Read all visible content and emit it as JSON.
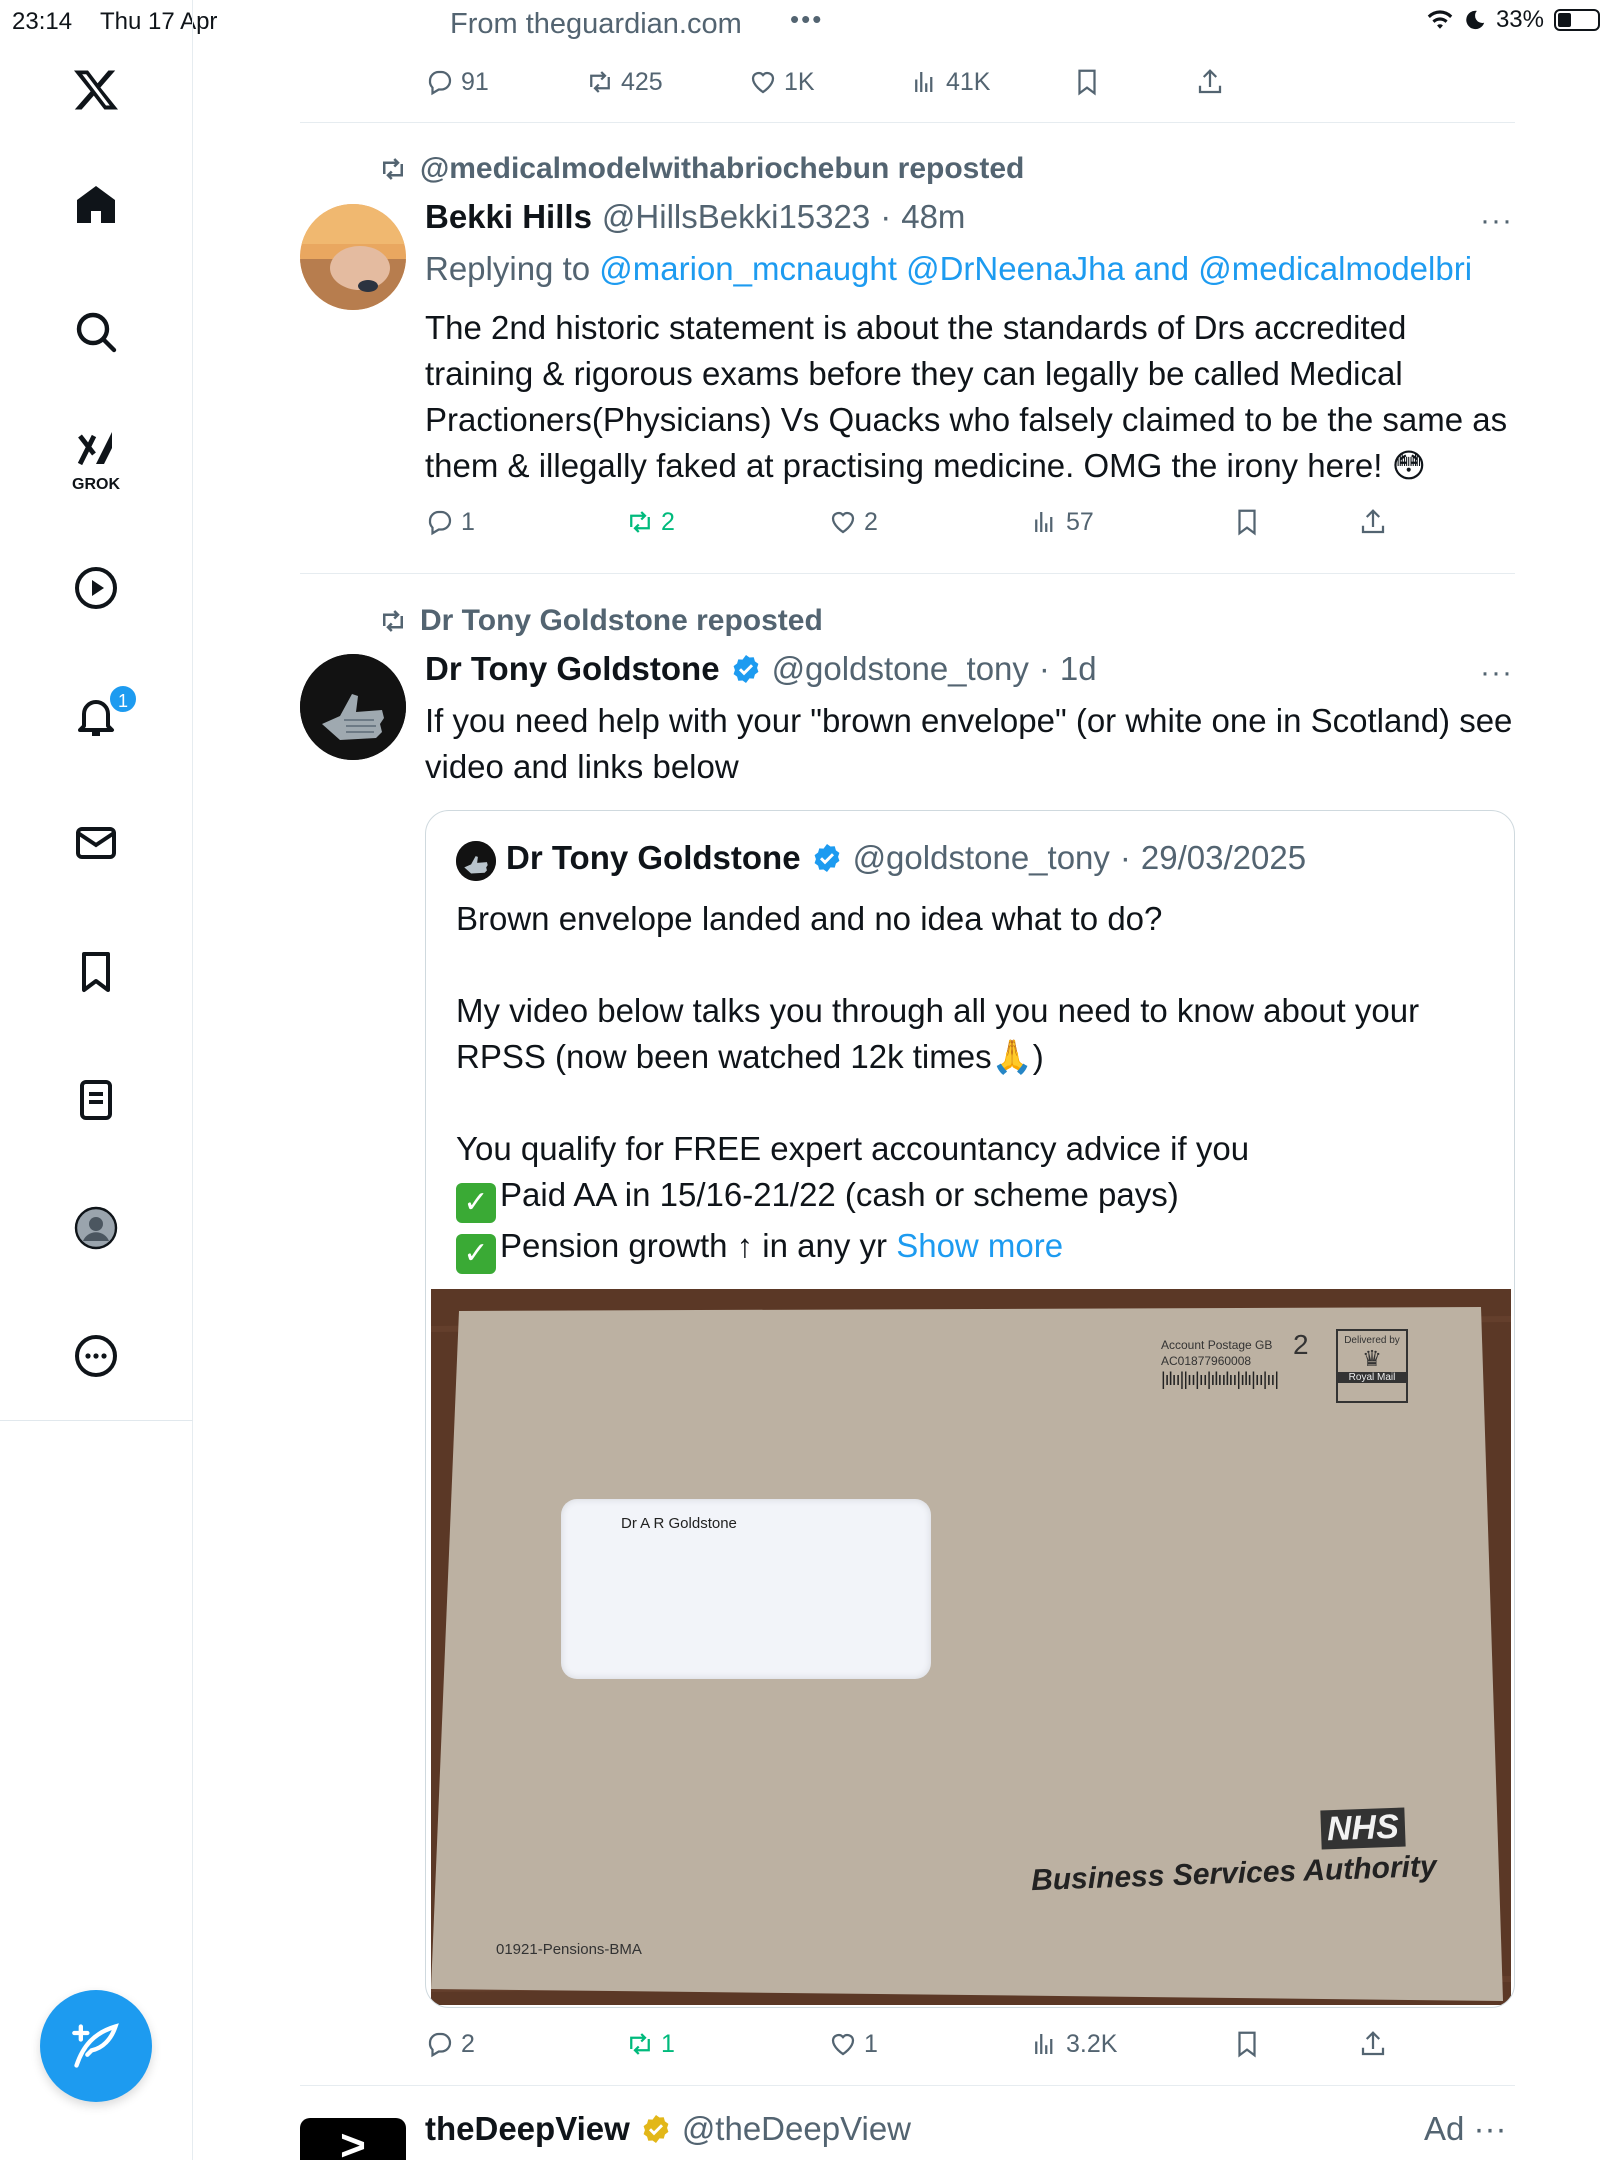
{
  "status_bar": {
    "time": "23:14",
    "date": "Thu 17 Apr",
    "battery": "33%",
    "battery_level": 0.33
  },
  "colors": {
    "accent": "#1d9bf0",
    "repost_green": "#00ba7c",
    "muted": "#536471"
  },
  "sidebar": {
    "items": [
      {
        "name": "x-logo",
        "icon": "x-logo-icon"
      },
      {
        "name": "home",
        "icon": "home-icon"
      },
      {
        "name": "explore",
        "icon": "search-icon"
      },
      {
        "name": "grok",
        "icon": "grok-icon",
        "label": "GROK"
      },
      {
        "name": "video",
        "icon": "play-icon"
      },
      {
        "name": "notifications",
        "icon": "bell-icon",
        "badge": "1"
      },
      {
        "name": "messages",
        "icon": "mail-icon"
      },
      {
        "name": "bookmarks",
        "icon": "bookmark-icon"
      },
      {
        "name": "lists",
        "icon": "list-icon"
      },
      {
        "name": "profile",
        "icon": "profile-icon"
      },
      {
        "name": "more",
        "icon": "more-circle-icon"
      }
    ],
    "compose_icon": "compose-icon"
  },
  "top_post": {
    "source": "From theguardian.com",
    "more": "•••",
    "replies": "91",
    "reposts": "425",
    "likes": "1K",
    "views": "41K"
  },
  "post1": {
    "repost_by": "@medicalmodelwithabriochebun reposted",
    "author_name": "Bekki Hills",
    "author_handle": "@HillsBekki15323",
    "time": "48m",
    "replying_prefix": "Replying to",
    "replying_to": "@marion_mcnaught @DrNeenaJha and @medicalmodelbri",
    "text": "The 2nd historic statement is about the standards of Drs accredited training & rigorous exams before they can legally be called Medical Practioners(Physicians) Vs Quacks who falsely claimed to be the same as them & illegally faked at practising medicine. OMG the irony here! 😳",
    "replies": "1",
    "reposts": "2",
    "likes": "2",
    "views": "57"
  },
  "post2": {
    "repost_by": "Dr Tony Goldstone reposted",
    "author_name": "Dr Tony Goldstone",
    "author_handle": "@goldstone_tony",
    "time": "1d",
    "text": "If you need help with your \"brown envelope\" (or white one in Scotland) see video and links below",
    "replies": "2",
    "reposts": "1",
    "likes": "1",
    "views": "3.2K",
    "quote": {
      "author_name": "Dr Tony Goldstone",
      "author_handle": "@goldstone_tony",
      "date": "29/03/2025",
      "line1": "Brown envelope landed and no idea what to do?",
      "line2": "My video below talks you through all you need to know about your RPSS (now been watched 12k times🙏)",
      "line3": "You qualify for FREE expert accountancy advice if you",
      "line4": "Paid AA in 15/16-21/22 (cash or scheme pays)",
      "line5": "Pension growth ↑ in any yr",
      "show_more": "Show more",
      "image": {
        "addressee": "Dr A R Goldstone",
        "postage_label": "Account Postage GB",
        "postage_code": "AC01877960008",
        "class": "2",
        "delivered_by": "Delivered by",
        "royal_mail": "Royal Mail",
        "nhs": "NHS",
        "authority": "Business Services Authority",
        "reference": "01921-Pensions-BMA"
      }
    }
  },
  "ad": {
    "logo_text": ">",
    "name": "theDeepView",
    "handle": "@theDeepView",
    "tag": "Ad",
    "more": "···"
  }
}
